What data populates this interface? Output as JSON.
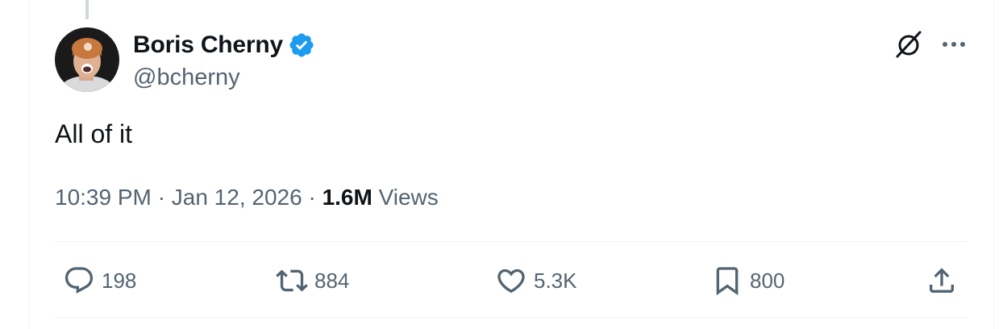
{
  "post": {
    "author": {
      "display_name": "Boris Cherny",
      "handle": "@bcherny",
      "verified": true,
      "avatar": "avatar-photo"
    },
    "text": "All of it",
    "time": "10:39 PM",
    "date": "Jan 12, 2026",
    "separator": "·",
    "views_count": "1.6M",
    "views_label": "Views"
  },
  "actions": {
    "replies": "198",
    "reposts": "884",
    "likes": "5.3K",
    "bookmarks": "800"
  },
  "icons": {
    "verified": "verified-badge-icon",
    "grok": "grok-icon",
    "more": "more-icon",
    "reply": "reply-icon",
    "repost": "repost-icon",
    "like": "heart-icon",
    "bookmark": "bookmark-icon",
    "share": "share-icon"
  },
  "colors": {
    "text_primary": "#0f1419",
    "text_secondary": "#536471",
    "verified_blue": "#1d9bf0",
    "divider": "#eff3f4"
  }
}
